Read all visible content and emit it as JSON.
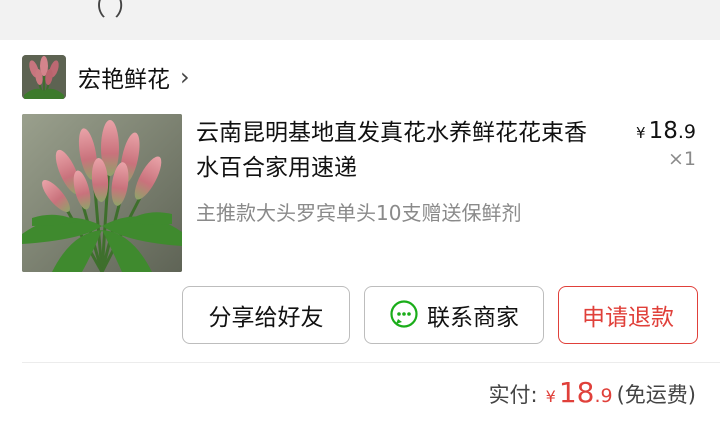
{
  "header": {
    "cut_text": "（  ）"
  },
  "shop": {
    "name": "宏艳鲜花",
    "chevron": "›"
  },
  "product": {
    "title": "云南昆明基地直发真花水养鲜花花束香水百合家用速递",
    "spec": "主推款大头罗宾单头10支赠送保鲜剂",
    "price_symbol": "¥",
    "price_int": "18",
    "price_dec": ".9",
    "quantity": "×1"
  },
  "actions": {
    "share_label": "分享给好友",
    "contact_label": "联系商家",
    "refund_label": "申请退款"
  },
  "total": {
    "label": "实付:",
    "symbol": "¥",
    "int": "18",
    "dec": ".9",
    "note": "(免运费)"
  },
  "colors": {
    "accent_red": "#e0403a",
    "wechat_green": "#1aad19",
    "page_bg": "#f2f2f2"
  },
  "icons": {
    "shop_avatar": "lily-bouquet-thumbnail",
    "contact": "wechat-chat-icon",
    "chevron": "chevron-right-icon"
  }
}
